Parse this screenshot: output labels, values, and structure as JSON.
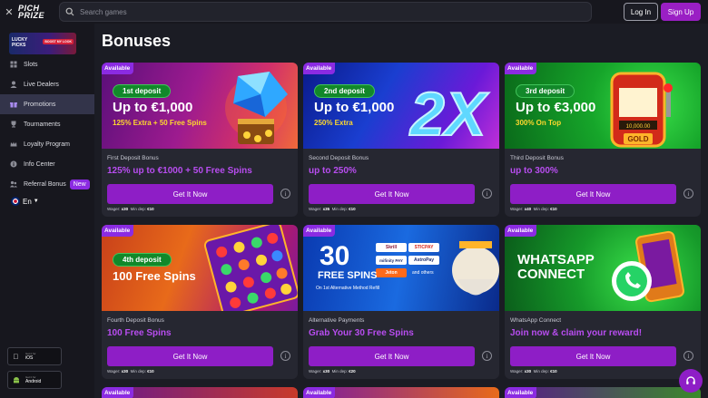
{
  "header": {
    "close_icon": "close-icon",
    "logo_text": "PICH PRIZE",
    "search_placeholder": "Search games",
    "login_label": "Log In",
    "signup_label": "Sign Up"
  },
  "sidebar": {
    "promo_banner": {
      "line1": "LUCKY",
      "line2": "PICKS",
      "badge": "BOOST MY LOOK"
    },
    "items": [
      {
        "label": "Slots",
        "icon": "slots-icon"
      },
      {
        "label": "Live Dealers",
        "icon": "dealer-icon"
      },
      {
        "label": "Promotions",
        "icon": "gift-icon",
        "active": true
      },
      {
        "label": "Tournaments",
        "icon": "trophy-icon"
      },
      {
        "label": "Loyalty Program",
        "icon": "crown-icon"
      },
      {
        "label": "Info Center",
        "icon": "info-icon"
      },
      {
        "label": "Referral Bonus",
        "icon": "referral-icon",
        "badge": "New"
      }
    ],
    "language": "En",
    "stores": [
      {
        "small": "Get it for",
        "name": "iOS",
        "icon": "apple-icon"
      },
      {
        "small": "Get it for",
        "name": "Android",
        "icon": "android-icon"
      }
    ]
  },
  "page_title": "Bonuses",
  "available_label": "Available",
  "cards": [
    {
      "pill": "1st deposit",
      "big": "Up to €1,000",
      "sub_art": "125% Extra + 50 Free Spins",
      "title": "First Deposit Bonus",
      "offer": "125% up to €1000 + 50 Free Spins",
      "cta": "Get It Now",
      "wager": "x30",
      "min_dep": "€10",
      "wager_label": "Wager:",
      "min_label": "Min dep:"
    },
    {
      "pill": "2nd deposit",
      "big": "Up to €1,000",
      "sub_art": "250% Extra",
      "art_word": "2X",
      "title": "Second Deposit Bonus",
      "offer": "up to 250%",
      "cta": "Get It Now",
      "wager": "x35",
      "min_dep": "€10",
      "wager_label": "Wager:",
      "min_label": "Min dep:"
    },
    {
      "pill": "3rd deposit",
      "big": "Up to €3,000",
      "sub_art": "300% On Top",
      "title": "Third Deposit Bonus",
      "offer": "up to 300%",
      "cta": "Get It Now",
      "wager": "x40",
      "min_dep": "€10",
      "wager_label": "Wager:",
      "min_label": "Min dep:",
      "machine_text": "10,000.00",
      "machine_word": "GOLD"
    },
    {
      "pill": "4th deposit",
      "big": "100 Free Spins",
      "title": "Fourth Deposit Bonus",
      "offer": "100 Free Spins",
      "cta": "Get It Now",
      "wager": "x30",
      "min_dep": "€10",
      "wager_label": "Wager:",
      "min_label": "Min dep:"
    },
    {
      "art_big": "30",
      "art_line": "FREE SPINS",
      "art_small": "On 1st Alternative Method Refill",
      "payments": [
        "Skrill",
        "STICPAY",
        "mifinity PAY",
        "AstroPay",
        "Jeton",
        "and others"
      ],
      "title": "Alternative Payments",
      "offer": "Grab Your 30 Free Spins",
      "cta": "Get It Now",
      "wager": "x30",
      "min_dep": "€20",
      "wager_label": "Wager:",
      "min_label": "Min dep:"
    },
    {
      "art_line1": "WHATSAPP",
      "art_line2": "CONNECT",
      "title": "WhatsApp Connect",
      "offer": "Join now & claim your reward!",
      "cta": "Get It Now",
      "wager": "x30",
      "min_dep": "€10",
      "wager_label": "Wager:",
      "min_label": "Min dep:"
    }
  ],
  "chat_icon": "headset-icon",
  "colors": {
    "accent": "#8e1ec6",
    "offer_text": "#b84df0",
    "available_badge": "#8b2be2",
    "pill_green": "#12882a"
  }
}
